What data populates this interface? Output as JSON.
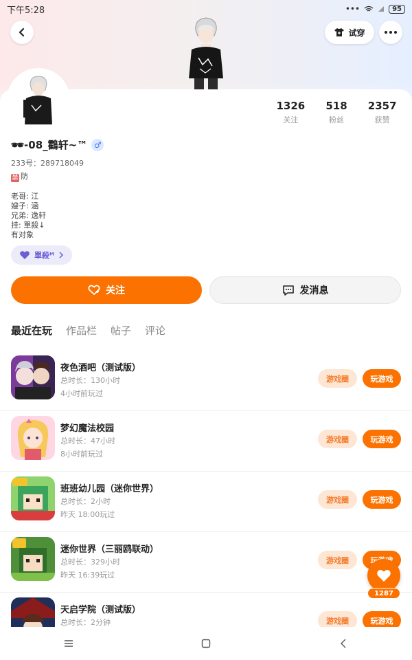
{
  "status_bar": {
    "time": "下午5:28",
    "battery": "95"
  },
  "header": {
    "try_on_label": "试穿"
  },
  "stats": [
    {
      "value": "1326",
      "label": "关注"
    },
    {
      "value": "518",
      "label": "粉丝"
    },
    {
      "value": "2357",
      "label": "获赞"
    }
  ],
  "profile": {
    "nickname": "🕶-08_鸖轩~™",
    "gender": "♂",
    "uid": "233号：289718049",
    "bio_tag": "禁",
    "bio_first": "防",
    "bio_lines": [
      "老哥: 江",
      "嫂子: 涵",
      "兄弟: 逸轩",
      "挂: 單殺↓",
      "有对象"
    ],
    "badge_label": "單殺ᴹ"
  },
  "actions": {
    "follow": "关注",
    "message": "发消息"
  },
  "tabs": [
    "最近在玩",
    "作品栏",
    "帖子",
    "评论"
  ],
  "games": [
    {
      "title": "夜色酒吧（测试版）",
      "duration": "总时长：130小时",
      "last": "4小时前玩过",
      "circle": "游戏圈",
      "play": "玩游戏"
    },
    {
      "title": "梦幻魔法校园",
      "duration": "总时长：47小时",
      "last": "8小时前玩过",
      "circle": "游戏圈",
      "play": "玩游戏"
    },
    {
      "title": "班班幼儿园（迷你世界）",
      "duration": "总时长：2小时",
      "last": "昨天 18:00玩过",
      "circle": "游戏圈",
      "play": "玩游戏"
    },
    {
      "title": "迷你世界（三丽鸥联动）",
      "duration": "总时长：329小时",
      "last": "昨天 16:39玩过",
      "circle": "游戏圈",
      "play": "玩游戏"
    },
    {
      "title": "天启学院（测试版）",
      "duration": "总时长：2分钟",
      "last": "",
      "circle": "游戏圈",
      "play": "玩游戏"
    }
  ],
  "float_like": {
    "count": "1287"
  },
  "colors": {
    "accent": "#fb7200",
    "circle_bg": "#fde6d3",
    "badge_bg": "#ecebfa",
    "gender": "#3a7bf2"
  },
  "icons": {
    "back": "back-arrow-icon",
    "more": "more-dots-icon",
    "shirt": "shirt-icon",
    "heart": "heart-icon",
    "chat": "chat-icon"
  }
}
